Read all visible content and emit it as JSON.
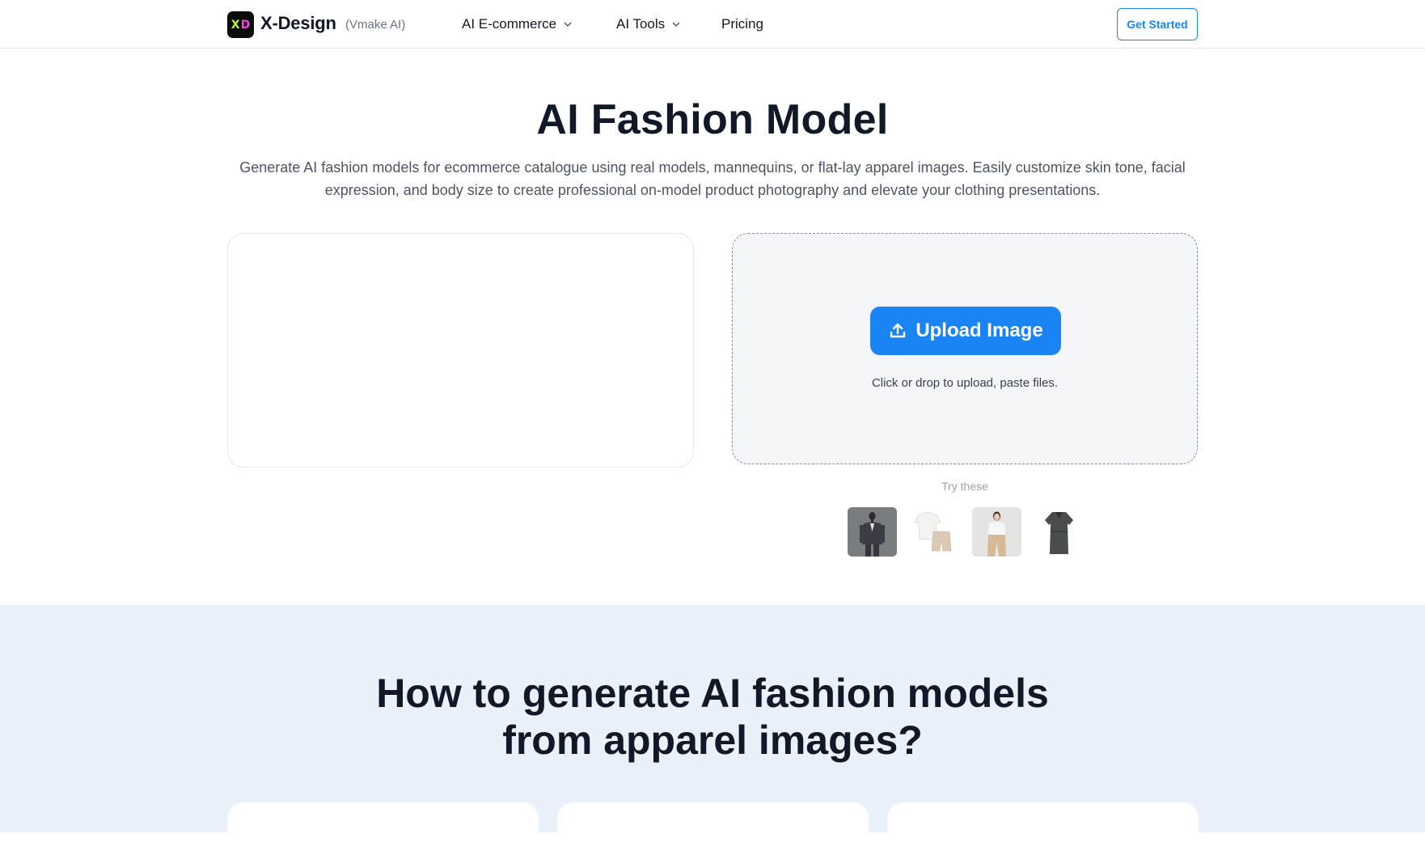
{
  "header": {
    "logo_text_x": "X",
    "logo_text_d": "D",
    "brand": "X-Design",
    "brand_sub": "(Vmake AI)",
    "nav": {
      "ecommerce": "AI E-commerce",
      "tools": "AI Tools",
      "pricing": "Pricing"
    },
    "cta": "Get Started"
  },
  "hero": {
    "title": "AI Fashion Model",
    "description": "Generate AI fashion models for ecommerce catalogue using real models, mannequins, or flat-lay apparel images. Easily customize skin tone, facial expression, and body size to create professional on-model product photography and elevate your clothing presentations."
  },
  "upload": {
    "button_label": "Upload Image",
    "hint": "Click or drop to upload, paste files.",
    "try_label": "Try these"
  },
  "how": {
    "title_line1": "How to generate AI fashion models",
    "title_line2": "from apparel images?"
  },
  "colors": {
    "accent": "#1a84f5",
    "section_bg": "#eaf1fb",
    "logo_lime": "#b8f23a",
    "logo_pink": "#ff3df0"
  }
}
